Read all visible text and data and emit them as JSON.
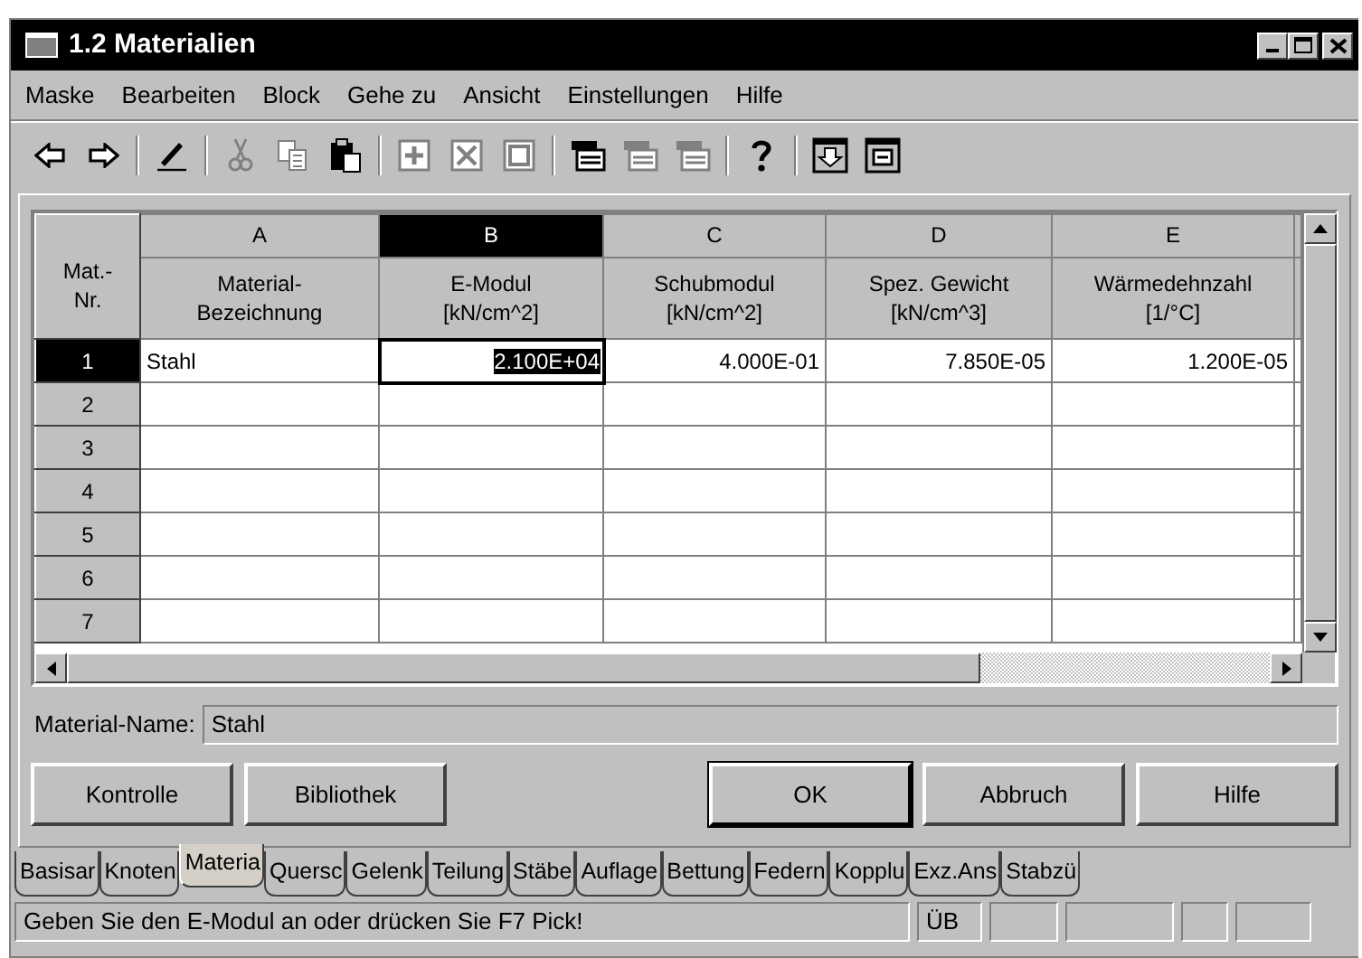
{
  "window": {
    "title": "1.2 Materialien"
  },
  "menu": [
    {
      "label": "Maske"
    },
    {
      "label": "Bearbeiten"
    },
    {
      "label": "Block"
    },
    {
      "label": "Gehe zu"
    },
    {
      "label": "Ansicht"
    },
    {
      "label": "Einstellungen"
    },
    {
      "label": "Hilfe"
    }
  ],
  "toolbar": [
    {
      "kind": "back",
      "disabled": false
    },
    {
      "kind": "forward",
      "disabled": false
    },
    {
      "kind": "separator"
    },
    {
      "kind": "pencil",
      "disabled": false
    },
    {
      "kind": "separator"
    },
    {
      "kind": "cut",
      "disabled": true
    },
    {
      "kind": "copy",
      "disabled": true
    },
    {
      "kind": "paste",
      "disabled": false
    },
    {
      "kind": "separator"
    },
    {
      "kind": "insert",
      "disabled": true
    },
    {
      "kind": "delete",
      "disabled": true
    },
    {
      "kind": "frame",
      "disabled": true
    },
    {
      "kind": "separator"
    },
    {
      "kind": "table",
      "disabled": false
    },
    {
      "kind": "table",
      "disabled": true
    },
    {
      "kind": "table",
      "disabled": true
    },
    {
      "kind": "separator"
    },
    {
      "kind": "help",
      "disabled": false
    },
    {
      "kind": "separator"
    },
    {
      "kind": "import",
      "disabled": false
    },
    {
      "kind": "list",
      "disabled": false
    }
  ],
  "grid": {
    "row_header": [
      "Mat.-",
      "Nr."
    ],
    "columns": [
      {
        "letter": "A",
        "title": [
          "Material-",
          "Bezeichnung"
        ],
        "kind": "text",
        "selected": false
      },
      {
        "letter": "B",
        "title": [
          "E-Modul",
          "[kN/cm^2]"
        ],
        "kind": "number",
        "selected": true
      },
      {
        "letter": "C",
        "title": [
          "Schubmodul",
          "[kN/cm^2]"
        ],
        "kind": "number",
        "selected": false
      },
      {
        "letter": "D",
        "title": [
          "Spez. Gewicht",
          "[kN/cm^3]"
        ],
        "kind": "number",
        "selected": false
      },
      {
        "letter": "E",
        "title": [
          "Wärmedehnzahl",
          "[1/°C]"
        ],
        "kind": "number",
        "selected": false
      }
    ],
    "rows": [
      {
        "number": "1",
        "selected": true,
        "cells": [
          {
            "text": "Stahl",
            "editing": false
          },
          {
            "text": "2.100E+04",
            "editing": true
          },
          {
            "text": "4.000E-01",
            "editing": false
          },
          {
            "text": "7.850E-05",
            "editing": false
          },
          {
            "text": "1.200E-05",
            "editing": false
          }
        ]
      },
      {
        "number": "2",
        "selected": false,
        "cells": []
      },
      {
        "number": "3",
        "selected": false,
        "cells": []
      },
      {
        "number": "4",
        "selected": false,
        "cells": []
      },
      {
        "number": "5",
        "selected": false,
        "cells": []
      },
      {
        "number": "6",
        "selected": false,
        "cells": []
      },
      {
        "number": "7",
        "selected": false,
        "cells": []
      }
    ]
  },
  "material_name": {
    "label": "Material-Name:",
    "value": "Stahl"
  },
  "buttons": [
    {
      "label": "Kontrolle",
      "default": false
    },
    {
      "label": "Bibliothek",
      "default": false
    },
    {
      "label": "OK",
      "default": true
    },
    {
      "label": "Abbruch",
      "default": false
    },
    {
      "label": "Hilfe",
      "default": false
    }
  ],
  "tabs": [
    {
      "label": "Basisar",
      "selected": false
    },
    {
      "label": "Knoten",
      "selected": false
    },
    {
      "label": "Materia",
      "selected": true
    },
    {
      "label": "Quersc",
      "selected": false
    },
    {
      "label": "Gelenk",
      "selected": false
    },
    {
      "label": "Teilung",
      "selected": false
    },
    {
      "label": "Stäbe",
      "selected": false
    },
    {
      "label": "Auflage",
      "selected": false
    },
    {
      "label": "Bettung",
      "selected": false
    },
    {
      "label": "Federn",
      "selected": false
    },
    {
      "label": "Kopplu",
      "selected": false
    },
    {
      "label": "Exz.Ans",
      "selected": false
    },
    {
      "label": "Stabzü",
      "selected": false
    }
  ],
  "status_bar": {
    "message": "Geben Sie den E-Modul an oder drücken Sie F7 Pick!",
    "panels": [
      "ÜB"
    ]
  }
}
